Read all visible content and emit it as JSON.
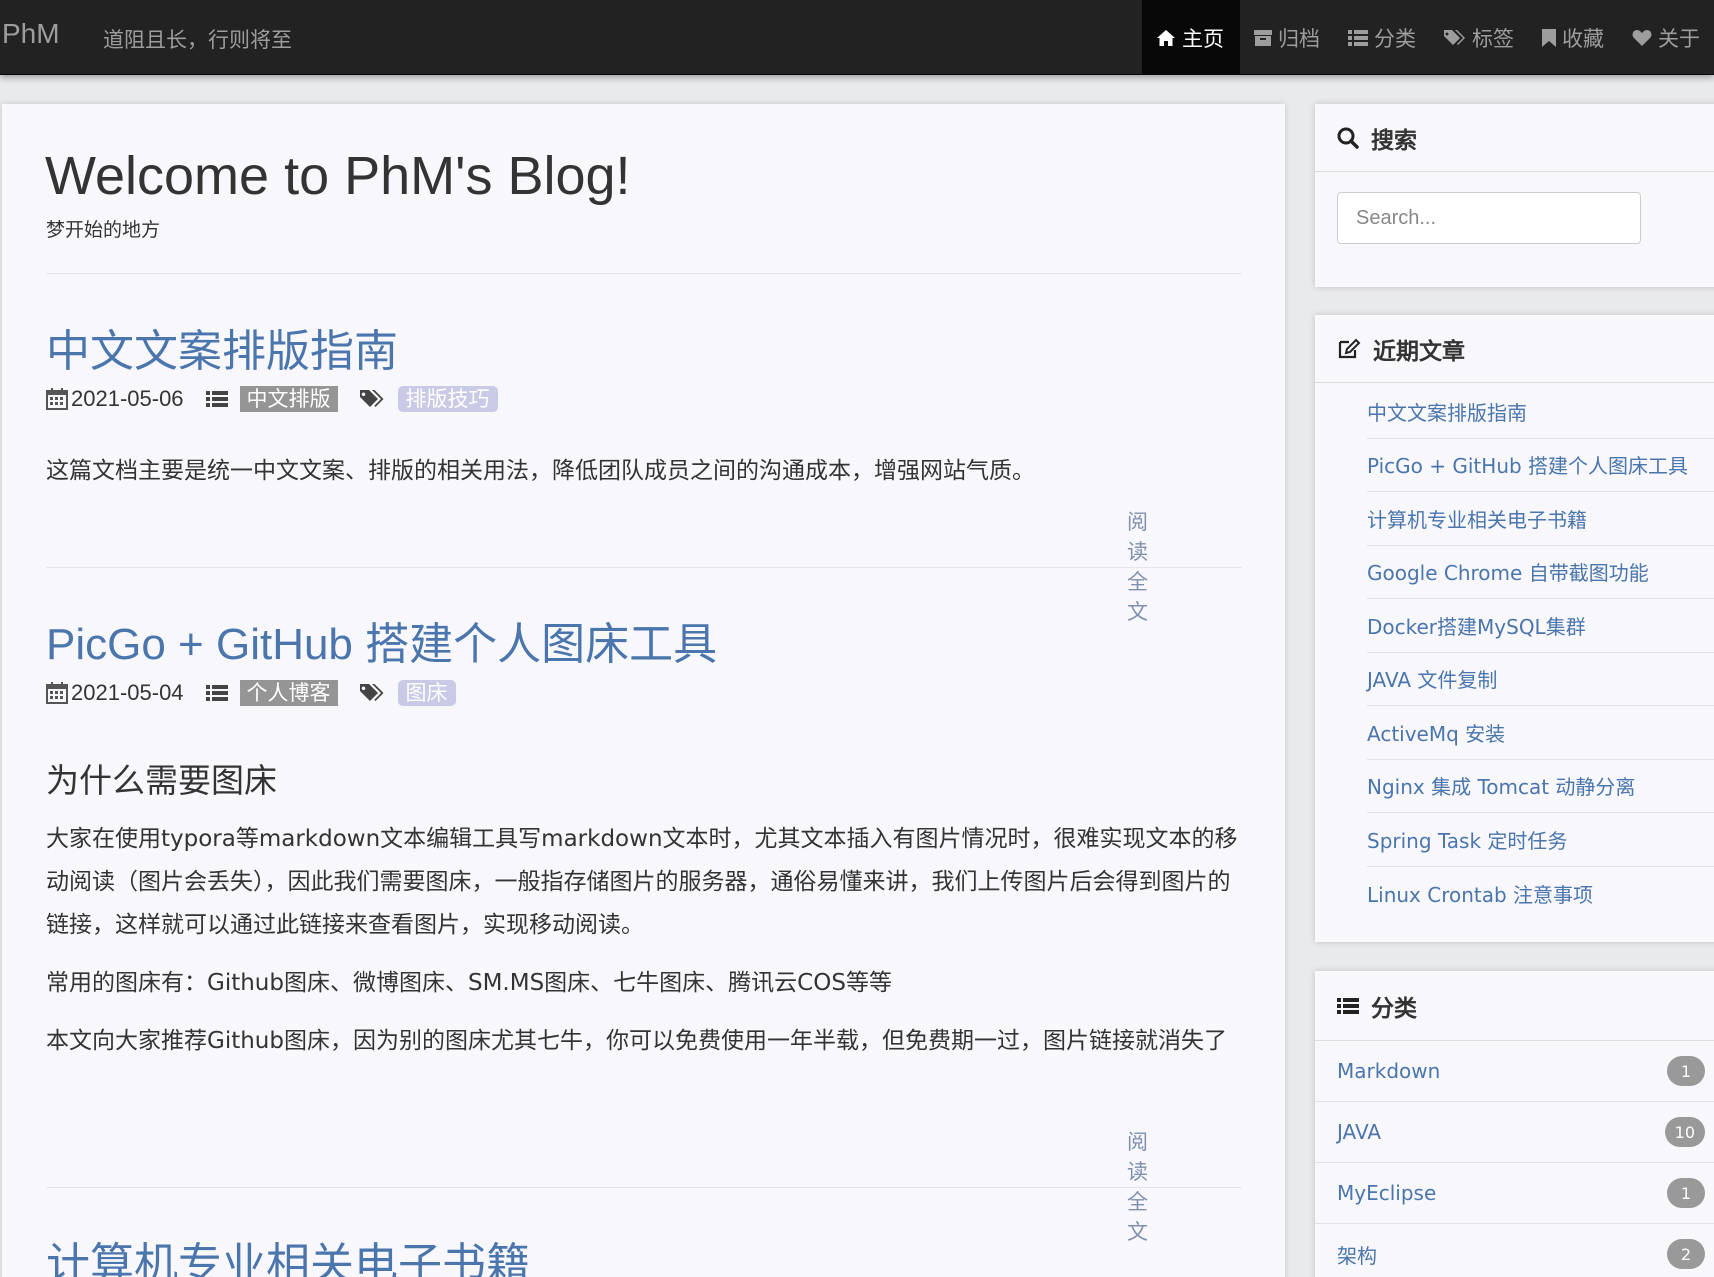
{
  "navbar": {
    "brand": "PhM",
    "motto": "道阻且长，行则将至",
    "items": [
      {
        "label": "主页",
        "icon": "home-icon",
        "active": true
      },
      {
        "label": "归档",
        "icon": "archive-icon"
      },
      {
        "label": "分类",
        "icon": "list-icon"
      },
      {
        "label": "标签",
        "icon": "tags-icon"
      },
      {
        "label": "收藏",
        "icon": "bookmark-icon"
      },
      {
        "label": "关于",
        "icon": "heart-icon"
      }
    ]
  },
  "header": {
    "title": "Welcome to PhM's Blog!",
    "subtitle": "梦开始的地方"
  },
  "posts": [
    {
      "title": "中文文案排版指南",
      "date": "2021-05-06",
      "category": "中文排版",
      "tag": "排版技巧",
      "excerpt": "这篇文档主要是统一中文文案、排版的相关用法，降低团队成员之间的沟通成本，增强网站气质。",
      "readmore": "阅读全文"
    },
    {
      "title": "PicGo + GitHub 搭建个人图床工具",
      "date": "2021-05-04",
      "category": "个人博客",
      "tag": "图床",
      "heading": "为什么需要图床",
      "paragraphs": [
        "大家在使用typora等markdown文本编辑工具写markdown文本时，尤其文本插入有图片情况时，很难实现文本的移动阅读（图片会丢失），因此我们需要图床，一般指存储图片的服务器，通俗易懂来讲，我们上传图片后会得到图片的链接，这样就可以通过此链接来查看图片，实现移动阅读。",
        "常用的图床有：Github图床、微博图床、SM.MS图床、七牛图床、腾讯云COS等等",
        "本文向大家推荐Github图床，因为别的图床尤其七牛，你可以免费使用一年半载，但免费期一过，图片链接就消失了"
      ],
      "readmore": "阅读全文"
    },
    {
      "title": "计算机专业相关电子书籍"
    }
  ],
  "sidebar": {
    "search": {
      "title": "搜索",
      "placeholder": "Search..."
    },
    "recent": {
      "title": "近期文章",
      "items": [
        "中文文案排版指南",
        "PicGo + GitHub 搭建个人图床工具",
        "计算机专业相关电子书籍",
        "Google Chrome 自带截图功能",
        "Docker搭建MySQL集群",
        "JAVA 文件复制",
        "ActiveMq 安装",
        "Nginx 集成 Tomcat 动静分离",
        "Spring Task 定时任务",
        "Linux Crontab 注意事项"
      ]
    },
    "categories": {
      "title": "分类",
      "items": [
        {
          "name": "Markdown",
          "count": "1"
        },
        {
          "name": "JAVA",
          "count": "10"
        },
        {
          "name": "MyEclipse",
          "count": "1"
        },
        {
          "name": "架构",
          "count": "2"
        }
      ]
    }
  }
}
